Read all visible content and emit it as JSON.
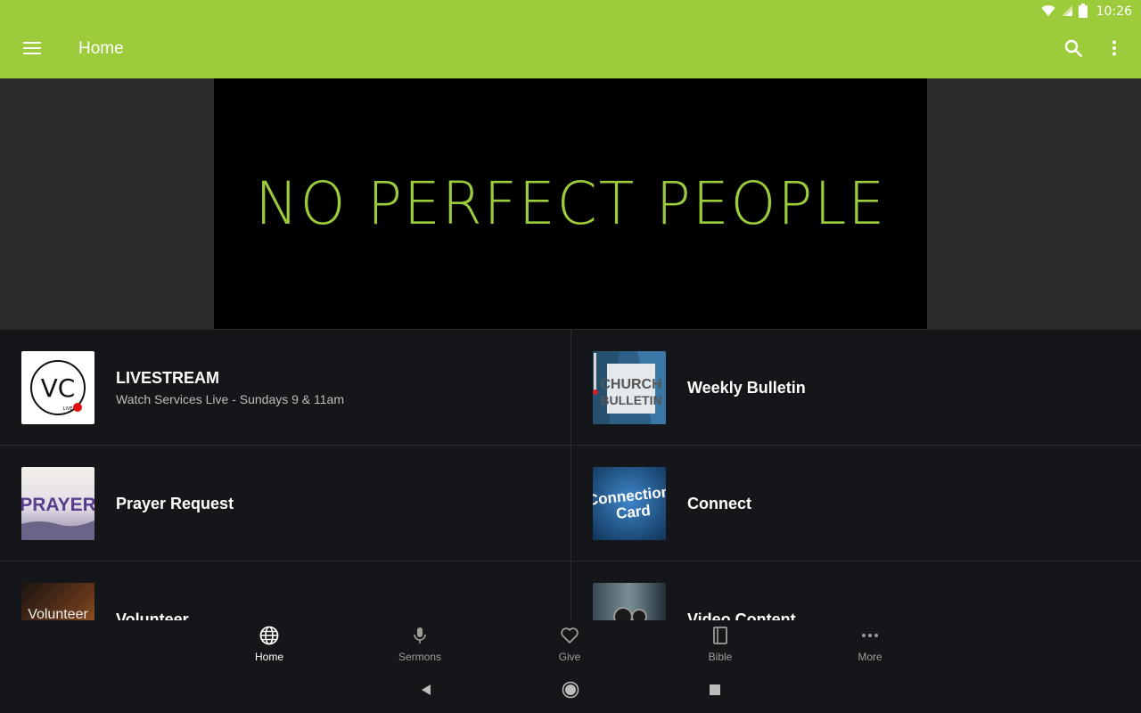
{
  "status_bar": {
    "time": "10:26"
  },
  "app_bar": {
    "title": "Home",
    "menu_icon": "hamburger-menu-icon",
    "search_icon": "search-icon",
    "overflow_icon": "more-vert-icon"
  },
  "hero": {
    "text": "NO PERFECT PEOPLE"
  },
  "items": [
    {
      "title": "LIVESTREAM",
      "subtitle": "Watch Services Live - Sundays 9 & 11am",
      "thumb_text": "VC",
      "thumb_badge": "LIVE"
    },
    {
      "title": "Weekly Bulletin",
      "thumb_text_1": "CHURCH",
      "thumb_text_2": "BULLETIN"
    },
    {
      "title": "Prayer Request",
      "thumb_text": "PRAYER"
    },
    {
      "title": "Connect",
      "thumb_text_1": "Connection",
      "thumb_text_2": "Card"
    },
    {
      "title": "Volunteer",
      "thumb_text": "Volunteer"
    },
    {
      "title": "Video Content"
    }
  ],
  "bottom_nav": [
    {
      "label": "Home",
      "icon": "globe-icon",
      "active": true
    },
    {
      "label": "Sermons",
      "icon": "microphone-icon"
    },
    {
      "label": "Give",
      "icon": "heart-icon"
    },
    {
      "label": "Bible",
      "icon": "book-icon"
    },
    {
      "label": "More",
      "icon": "more-horiz-icon"
    }
  ],
  "colors": {
    "brand": "#9ccb3b",
    "background": "#151619"
  }
}
